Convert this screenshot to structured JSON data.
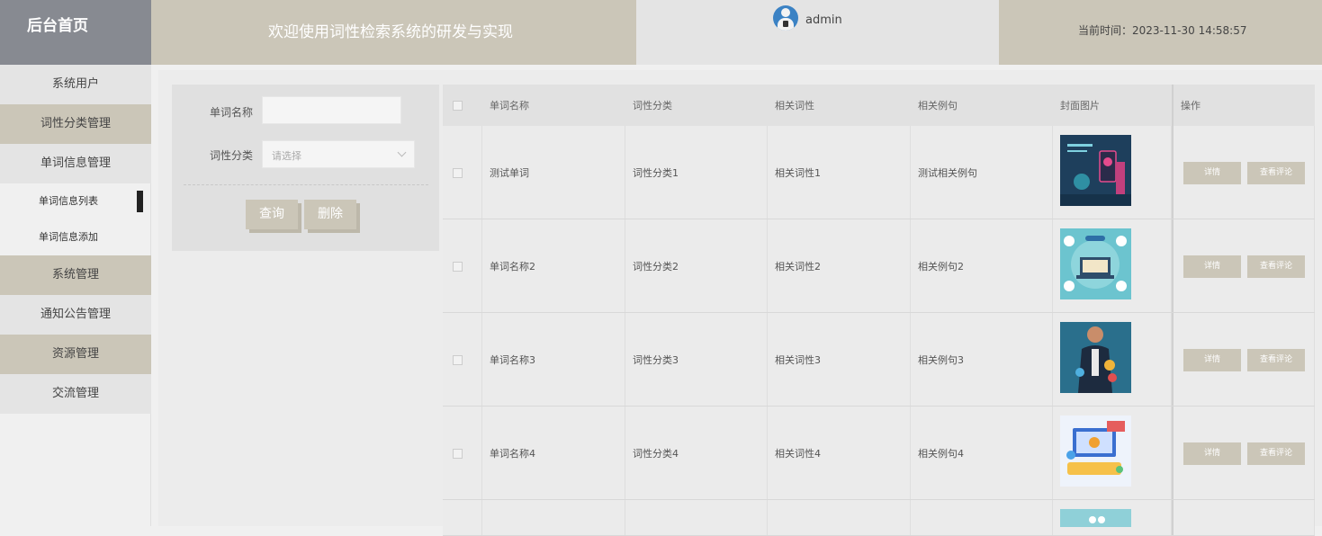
{
  "header": {
    "brand": "后台首页",
    "title": "欢迎使用词性检索系统的研发与实现",
    "username": "admin",
    "time_label": "当前时间：",
    "time_value": "2023-11-30 14:58:57"
  },
  "sidebar": {
    "items": [
      {
        "label": "系统用户"
      },
      {
        "label": "词性分类管理"
      },
      {
        "label": "单词信息管理"
      },
      {
        "label": "单词信息列表"
      },
      {
        "label": "单词信息添加"
      },
      {
        "label": "系统管理"
      },
      {
        "label": "通知公告管理"
      },
      {
        "label": "资源管理"
      },
      {
        "label": "交流管理"
      }
    ]
  },
  "search": {
    "word_label": "单词名称",
    "word_value": "",
    "category_label": "词性分类",
    "category_placeholder": "请选择",
    "query_button": "查询",
    "delete_button": "删除"
  },
  "table": {
    "columns": [
      "单词名称",
      "词性分类",
      "相关词性",
      "相关例句",
      "封面图片",
      "操作"
    ],
    "rows": [
      {
        "word": "测试单词",
        "category": "词性分类1",
        "pos": "相关词性1",
        "example": "测试相关例句"
      },
      {
        "word": "单词名称2",
        "category": "词性分类2",
        "pos": "相关词性2",
        "example": "相关例句2"
      },
      {
        "word": "单词名称3",
        "category": "词性分类3",
        "pos": "相关词性3",
        "example": "相关例句3"
      },
      {
        "word": "单词名称4",
        "category": "词性分类4",
        "pos": "相关词性4",
        "example": "相关例句4"
      }
    ],
    "detail_button": "详情",
    "comment_button": "查看评论"
  },
  "colors": {
    "accent": "#cbc6b8",
    "brand_bg": "#878a91"
  }
}
